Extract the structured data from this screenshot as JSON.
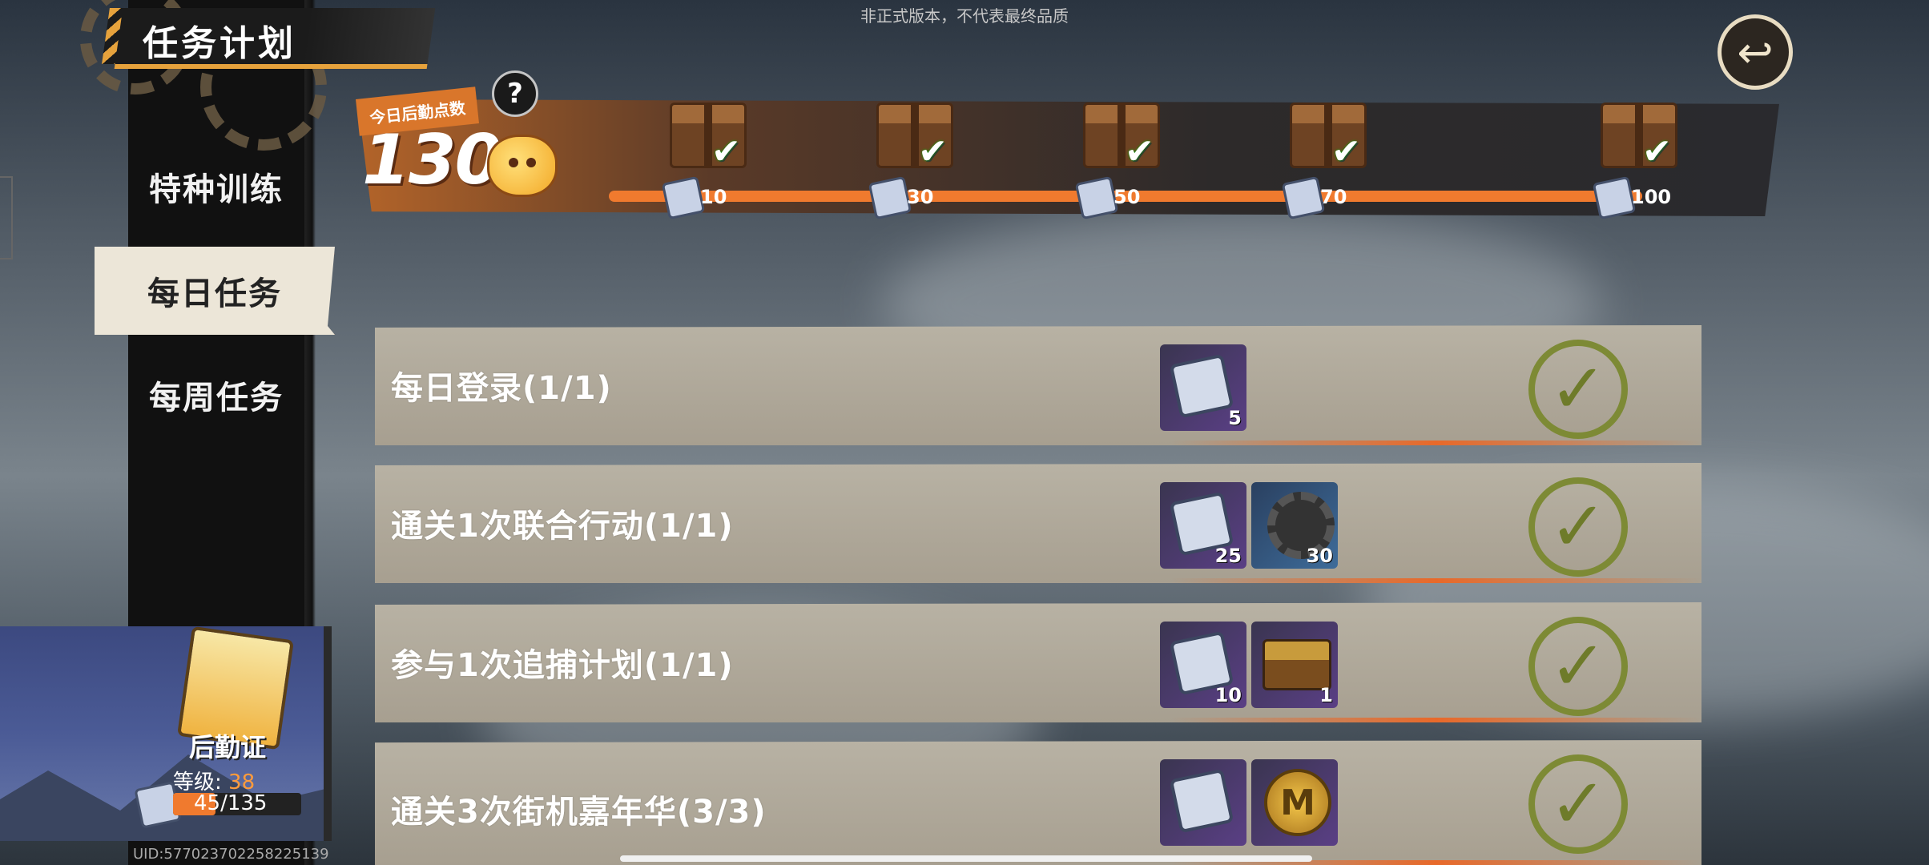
{
  "watermark": "非正式版本，不代表最终品质",
  "title": "任务计划",
  "nav": {
    "special_training": "特种训练",
    "daily_tasks": "每日任务",
    "weekly_tasks": "每周任务"
  },
  "points": {
    "label": "今日后勤点数",
    "value": "130",
    "help": "?",
    "milestones": [
      "10",
      "30",
      "50",
      "70",
      "100"
    ]
  },
  "tasks": [
    {
      "name": "每日登录(1/1)",
      "rewards": [
        "5"
      ]
    },
    {
      "name": "通关1次联合行动(1/1)",
      "rewards": [
        "25",
        "30"
      ]
    },
    {
      "name": "参与1次追捕计划(1/1)",
      "rewards": [
        "10",
        "1"
      ]
    },
    {
      "name": "通关3次街机嘉年华(3/3)",
      "rewards": []
    }
  ],
  "card": {
    "title": "后勤证",
    "level_label": "等级: ",
    "level_value": "38",
    "progress_text": "45/135",
    "progress_fraction": 0.333
  },
  "uid": "UID:577023702258225139",
  "colors": {
    "accent": "#f07a2e",
    "check": "#7d8a35"
  }
}
